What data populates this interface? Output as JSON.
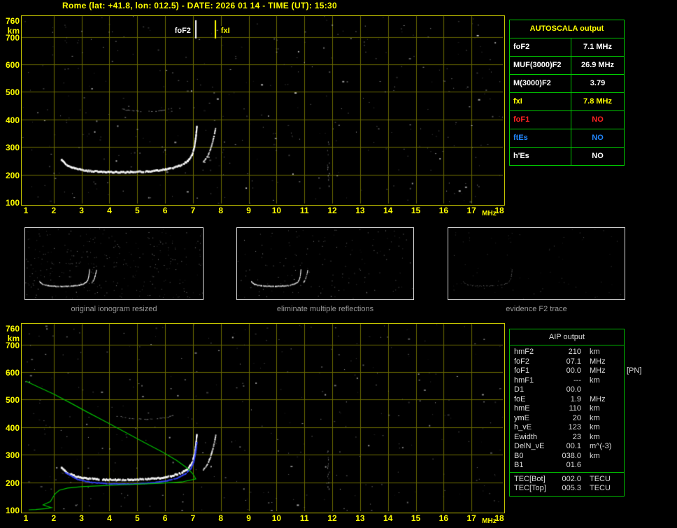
{
  "header": {
    "title": "Rome (lat: +41.8, lon: 012.5) - DATE: 2026 01 14 - TIME (UT): 15:30"
  },
  "colors": {
    "background": "#000000",
    "axis_text": "#ffff00",
    "plot_border": "#c8c800",
    "grid": "#6a6a00",
    "table_border": "#00cc00",
    "trace_white": "#ffffff",
    "profile_green": "#00c000",
    "restored_blue": "#3344ff",
    "foF1_red": "#ff2222",
    "ftEs_blue": "#2288ff",
    "caption_grey": "#9a9a9a"
  },
  "autoscala_table": {
    "title": "AUTOSCALA output",
    "rows": [
      {
        "label": "foF2",
        "value": "7.1 MHz",
        "color": "#ffffff"
      },
      {
        "label": "MUF(3000)F2",
        "value": "26.9 MHz",
        "color": "#ffffff"
      },
      {
        "label": "M(3000)F2",
        "value": "3.79",
        "color": "#ffffff"
      },
      {
        "label": "fxI",
        "value": "7.8 MHz",
        "color": "#ffff00"
      },
      {
        "label": "foF1",
        "value": "NO",
        "color": "#ff2222"
      },
      {
        "label": "ftEs",
        "value": "NO",
        "color": "#2288ff"
      },
      {
        "label": "h'Es",
        "value": "NO",
        "color": "#ffffff"
      }
    ]
  },
  "thumbnails": [
    {
      "caption": "original ionogram resized",
      "mode": "original"
    },
    {
      "caption": "eliminate multiple reflections",
      "mode": "filtered"
    },
    {
      "caption": "evidence F2 trace",
      "mode": "f2"
    }
  ],
  "aip_table": {
    "title": "AIP output",
    "rows": [
      {
        "label": "hmF2",
        "value": "210",
        "unit": "km",
        "note": ""
      },
      {
        "label": "foF2",
        "value": "07.1",
        "unit": "MHz",
        "note": ""
      },
      {
        "label": "foF1",
        "value": "00.0",
        "unit": "MHz",
        "note": "[PN]"
      },
      {
        "label": "hmF1",
        "value": "---",
        "unit": "km",
        "note": ""
      },
      {
        "label": "D1",
        "value": "00.0",
        "unit": "",
        "note": ""
      },
      {
        "label": "foE",
        "value": "1.9",
        "unit": "MHz",
        "note": ""
      },
      {
        "label": "hmE",
        "value": "110",
        "unit": "km",
        "note": ""
      },
      {
        "label": "ymE",
        "value": "20",
        "unit": "km",
        "note": ""
      },
      {
        "label": "h_vE",
        "value": "123",
        "unit": "km",
        "note": ""
      },
      {
        "label": "Ewidth",
        "value": "23",
        "unit": "km",
        "note": ""
      },
      {
        "label": "DelN_vE",
        "value": "00.1",
        "unit": "m^(-3)",
        "note": ""
      },
      {
        "label": "B0",
        "value": "038.0",
        "unit": "km",
        "note": ""
      },
      {
        "label": "B1",
        "value": "01.6",
        "unit": "",
        "note": ""
      }
    ],
    "tec_rows": [
      {
        "label": "TEC[Bot]",
        "value": "002.0",
        "unit": "TECU"
      },
      {
        "label": "TEC[Top]",
        "value": "005.3",
        "unit": "TECU"
      }
    ]
  },
  "chart_data": [
    {
      "type": "scatter",
      "title": "Rome ionogram 2026-01-14 15:30 UT with AUTOSCALA markers",
      "xlabel": "MHz",
      "ylabel": "km",
      "xlim": [
        1,
        18
      ],
      "ylim": [
        100,
        760
      ],
      "x_ticks": [
        1,
        2,
        3,
        4,
        5,
        6,
        7,
        8,
        9,
        10,
        11,
        12,
        13,
        14,
        15,
        16,
        17,
        18
      ],
      "y_ticks": [
        760,
        700,
        600,
        500,
        400,
        300,
        200,
        100
      ],
      "grid": true,
      "markers": [
        {
          "label": "foF2",
          "x": 7.1,
          "color": "#ffffff"
        },
        {
          "label": "fxI",
          "x": 7.8,
          "color": "#ffff00"
        }
      ],
      "series": [
        {
          "name": "F2 ordinary trace",
          "points": [
            [
              2.25,
              258
            ],
            [
              2.45,
              238
            ],
            [
              2.8,
              224
            ],
            [
              3.2,
              217
            ],
            [
              3.8,
              213
            ],
            [
              4.5,
              212
            ],
            [
              5.2,
              214
            ],
            [
              5.8,
              219
            ],
            [
              6.2,
              226
            ],
            [
              6.55,
              237
            ],
            [
              6.8,
              253
            ],
            [
              6.95,
              275
            ],
            [
              7.03,
              305
            ],
            [
              7.08,
              340
            ],
            [
              7.12,
              380
            ]
          ]
        },
        {
          "name": "F2 extraordinary trace",
          "points": [
            [
              7.35,
              248
            ],
            [
              7.5,
              268
            ],
            [
              7.6,
              292
            ],
            [
              7.68,
              320
            ],
            [
              7.75,
              350
            ],
            [
              7.8,
              375
            ]
          ]
        },
        {
          "name": "second reflection",
          "points": [
            [
              4.2,
              442
            ],
            [
              4.7,
              434
            ],
            [
              5.2,
              430
            ],
            [
              5.7,
              432
            ],
            [
              6.1,
              438
            ],
            [
              6.35,
              448
            ]
          ]
        }
      ],
      "noise": {
        "count": 380,
        "seed": 11,
        "streaks": [
          {
            "x": 11.85,
            "h1": 150,
            "h2": 320
          }
        ]
      }
    },
    {
      "type": "scatter",
      "title": "Rome ionogram with AIP restored trace and electron density profile",
      "xlabel": "MHz",
      "ylabel": "km",
      "xlim": [
        1,
        18
      ],
      "ylim": [
        100,
        760
      ],
      "x_ticks": [
        1,
        2,
        3,
        4,
        5,
        6,
        7,
        8,
        9,
        10,
        11,
        12,
        13,
        14,
        15,
        16,
        17,
        18
      ],
      "y_ticks": [
        760,
        700,
        600,
        500,
        400,
        300,
        200,
        100
      ],
      "grid": true,
      "series": [
        {
          "name": "F2 ordinary trace",
          "points": [
            [
              2.25,
              258
            ],
            [
              2.45,
              238
            ],
            [
              2.8,
              224
            ],
            [
              3.2,
              217
            ],
            [
              3.8,
              213
            ],
            [
              4.5,
              212
            ],
            [
              5.2,
              214
            ],
            [
              5.8,
              219
            ],
            [
              6.2,
              226
            ],
            [
              6.55,
              237
            ],
            [
              6.8,
              253
            ],
            [
              6.95,
              275
            ],
            [
              7.03,
              305
            ],
            [
              7.08,
              340
            ],
            [
              7.12,
              380
            ]
          ]
        },
        {
          "name": "F2 extraordinary trace",
          "points": [
            [
              7.35,
              248
            ],
            [
              7.5,
              268
            ],
            [
              7.6,
              292
            ],
            [
              7.68,
              320
            ],
            [
              7.75,
              350
            ],
            [
              7.8,
              375
            ]
          ]
        },
        {
          "name": "second reflection",
          "points": [
            [
              4.2,
              442
            ],
            [
              4.7,
              434
            ],
            [
              5.2,
              430
            ],
            [
              5.7,
              432
            ],
            [
              6.1,
              438
            ],
            [
              6.35,
              448
            ]
          ]
        }
      ],
      "fitted": {
        "name": "restored trace",
        "color": "#3344ff",
        "points": [
          [
            2.4,
            238
          ],
          [
            2.8,
            214
          ],
          [
            3.3,
            202
          ],
          [
            4,
            197
          ],
          [
            4.8,
            196
          ],
          [
            5.5,
            200
          ],
          [
            6,
            207
          ],
          [
            6.4,
            217
          ],
          [
            6.7,
            232
          ],
          [
            6.9,
            252
          ],
          [
            7.0,
            275
          ],
          [
            7.07,
            310
          ],
          [
            7.12,
            350
          ]
        ]
      },
      "profile": {
        "name": "electron density profile",
        "color": "#00c000",
        "points": [
          [
            1.0,
            567
          ],
          [
            1.4,
            548
          ],
          [
            2.0,
            520
          ],
          [
            2.6,
            488
          ],
          [
            3.2,
            455
          ],
          [
            3.9,
            418
          ],
          [
            4.6,
            380
          ],
          [
            5.3,
            342
          ],
          [
            5.9,
            310
          ],
          [
            6.4,
            280
          ],
          [
            6.8,
            251
          ],
          [
            7.0,
            230
          ],
          [
            7.1,
            212
          ],
          [
            6.6,
            201
          ],
          [
            5.8,
            196
          ],
          [
            4.8,
            192
          ],
          [
            3.8,
            188
          ],
          [
            3.0,
            184
          ],
          [
            2.5,
            179
          ],
          [
            2.2,
            171
          ],
          [
            2.05,
            158
          ],
          [
            1.95,
            142
          ],
          [
            1.88,
            130
          ],
          [
            1.75,
            124
          ],
          [
            1.62,
            118
          ],
          [
            1.78,
            112
          ],
          [
            1.92,
            108
          ],
          [
            1.7,
            104
          ],
          [
            1.35,
            101
          ],
          [
            1.1,
            100
          ]
        ]
      },
      "noise": {
        "count": 330,
        "seed": 23,
        "streaks": [
          {
            "x": 11.85,
            "h1": 160,
            "h2": 330
          }
        ]
      }
    }
  ]
}
